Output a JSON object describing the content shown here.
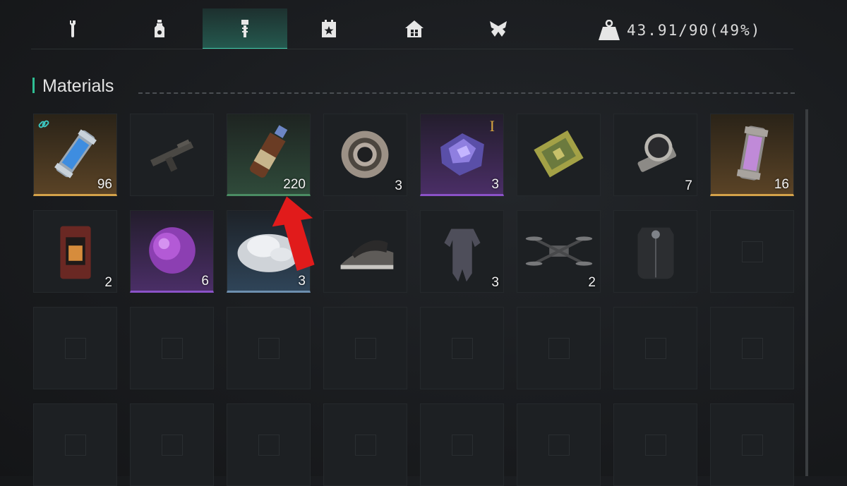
{
  "tabs": [
    {
      "icon": "wrench-icon",
      "active": false
    },
    {
      "icon": "bottle-icon",
      "active": false
    },
    {
      "icon": "bolt-icon",
      "active": true
    },
    {
      "icon": "calendar-icon",
      "active": false
    },
    {
      "icon": "house-icon",
      "active": false
    },
    {
      "icon": "wings-icon",
      "active": false
    }
  ],
  "weight": {
    "icon": "weight-icon",
    "text": "43.91/90(49%)"
  },
  "section": {
    "title": "Materials"
  },
  "colors": {
    "accent": "#3fd0ad",
    "gold": "#d4a24a",
    "purple": "#8b52c8",
    "green": "#4b8c63",
    "blue": "#6d8faf",
    "arrow": "#e11b1b"
  },
  "items": [
    {
      "name": "blue-canister-item",
      "qty": "96",
      "rarity": "gold",
      "badge": "link-icon"
    },
    {
      "name": "rifle-part-item",
      "qty": "",
      "rarity": "none"
    },
    {
      "name": "bottle-item",
      "qty": "220",
      "rarity": "green"
    },
    {
      "name": "bearing-item",
      "qty": "3",
      "rarity": "none"
    },
    {
      "name": "purple-crystal-item",
      "qty": "3",
      "rarity": "purple",
      "tier": "I"
    },
    {
      "name": "circuit-chip-item",
      "qty": "",
      "rarity": "none"
    },
    {
      "name": "wristwatch-item",
      "qty": "7",
      "rarity": "none"
    },
    {
      "name": "pink-canister-item",
      "qty": "16",
      "rarity": "gold"
    },
    {
      "name": "heater-item",
      "qty": "2",
      "rarity": "none"
    },
    {
      "name": "purple-orb-item",
      "qty": "6",
      "rarity": "purple"
    },
    {
      "name": "salt-crystals-item",
      "qty": "3",
      "rarity": "blue"
    },
    {
      "name": "clothes-iron-item",
      "qty": "",
      "rarity": "none"
    },
    {
      "name": "jumpsuit-item",
      "qty": "3",
      "rarity": "none"
    },
    {
      "name": "drone-item",
      "qty": "2",
      "rarity": "none"
    },
    {
      "name": "armor-vest-item",
      "qty": "",
      "rarity": "none"
    }
  ],
  "grid": {
    "columns": 8,
    "visible_rows": 4
  }
}
